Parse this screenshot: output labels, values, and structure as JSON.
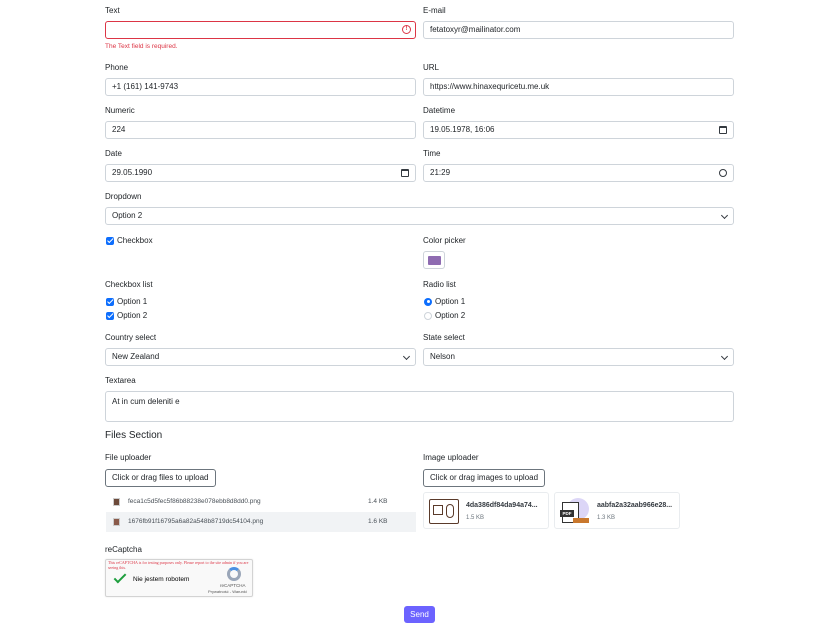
{
  "fields": {
    "text": {
      "label": "Text",
      "value": "",
      "error": "The Text field is required."
    },
    "email": {
      "label": "E-mail",
      "value": "fetatoxyr@mailinator.com"
    },
    "phone": {
      "label": "Phone",
      "value": "+1 (161) 141-9743"
    },
    "url": {
      "label": "URL",
      "value": "https://www.hinaxequricetu.me.uk"
    },
    "numeric": {
      "label": "Numeric",
      "value": "224"
    },
    "datetime": {
      "label": "Datetime",
      "value": "19.05.1978, 16:06"
    },
    "date": {
      "label": "Date",
      "value": "29.05.1990"
    },
    "time": {
      "label": "Time",
      "value": "21:29"
    },
    "dropdown": {
      "label": "Dropdown",
      "value": "Option 2"
    },
    "checkbox": {
      "label": "Checkbox",
      "checked": true
    },
    "color_picker": {
      "label": "Color picker",
      "color": "#8e6bb1"
    },
    "checkbox_list": {
      "label": "Checkbox list",
      "options": [
        "Option 1",
        "Option 2"
      ]
    },
    "radio_list": {
      "label": "Radio list",
      "options": [
        "Option 1",
        "Option 2"
      ],
      "selected": "Option 1"
    },
    "country": {
      "label": "Country select",
      "value": "New Zealand"
    },
    "state": {
      "label": "State select",
      "value": "Nelson"
    },
    "textarea": {
      "label": "Textarea",
      "value": "At in cum deleniti e"
    }
  },
  "files_section": {
    "title": "Files Section",
    "file_uploader": {
      "label": "File uploader",
      "button": "Click or drag files to upload",
      "files": [
        {
          "name": "feca1c5d5fec5f86b88238e078ebb8d8dd0.png",
          "size": "1.4 KB"
        },
        {
          "name": "1676fb91f16795a6a82a548b8719dc54104.png",
          "size": "1.6 KB"
        }
      ]
    },
    "image_uploader": {
      "label": "Image uploader",
      "button": "Click or drag images to upload",
      "images": [
        {
          "name": "4da386df84da94a74...",
          "size": "1.5 KB",
          "icon": "image-thumbnail-icon"
        },
        {
          "name": "aabfa2a32aab966e28...",
          "size": "1.3 KB",
          "icon": "pdf-file-icon"
        }
      ]
    }
  },
  "recaptcha": {
    "label": "reCaptcha",
    "notice": "This reCAPTCHA is for testing purposes only. Please report to the site admin if you are seeing this.",
    "checkbox_label": "Nie jestem robotem",
    "brand": "reCAPTCHA",
    "links": "Prywatność - Warunki"
  },
  "submit": {
    "label": "Send",
    "color": "#6c63ff"
  },
  "colors": {
    "primary": "#0d6efd",
    "danger": "#dc3545",
    "border": "#ced4da"
  }
}
